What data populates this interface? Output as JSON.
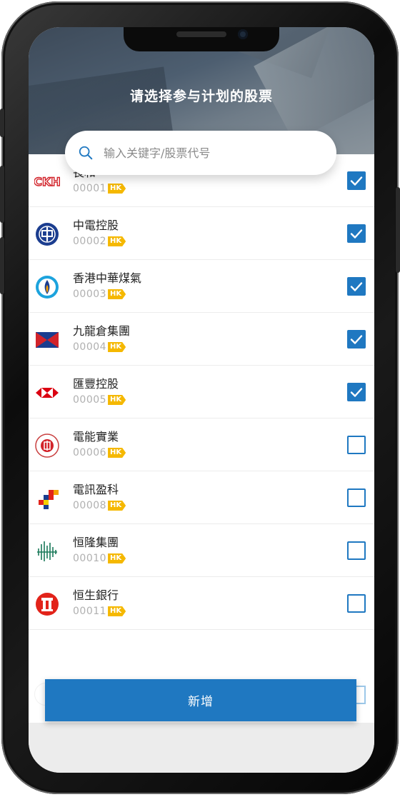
{
  "header": {
    "title": "请选择参与计划的股票"
  },
  "search": {
    "placeholder": "输入关键字/股票代号"
  },
  "stocks": [
    {
      "name": "長和",
      "code": "00001",
      "market": "HK",
      "checked": true,
      "icon": "ckh-logo-icon"
    },
    {
      "name": "中電控股",
      "code": "00002",
      "market": "HK",
      "checked": true,
      "icon": "clp-logo-icon"
    },
    {
      "name": "香港中華煤氣",
      "code": "00003",
      "market": "HK",
      "checked": true,
      "icon": "towngas-logo-icon"
    },
    {
      "name": "九龍倉集團",
      "code": "00004",
      "market": "HK",
      "checked": true,
      "icon": "wharf-logo-icon"
    },
    {
      "name": "匯豐控股",
      "code": "00005",
      "market": "HK",
      "checked": true,
      "icon": "hsbc-logo-icon"
    },
    {
      "name": "電能實業",
      "code": "00006",
      "market": "HK",
      "checked": false,
      "icon": "power-assets-logo-icon"
    },
    {
      "name": "電訊盈科",
      "code": "00008",
      "market": "HK",
      "checked": false,
      "icon": "pccw-logo-icon"
    },
    {
      "name": "恒隆集團",
      "code": "00010",
      "market": "HK",
      "checked": false,
      "icon": "hang-lung-logo-icon"
    },
    {
      "name": "恒生銀行",
      "code": "00011",
      "market": "HK",
      "checked": false,
      "icon": "hang-seng-logo-icon"
    }
  ],
  "actions": {
    "add_label": "新增"
  },
  "colors": {
    "accent": "#1f78c1",
    "badge": "#f5b800"
  }
}
